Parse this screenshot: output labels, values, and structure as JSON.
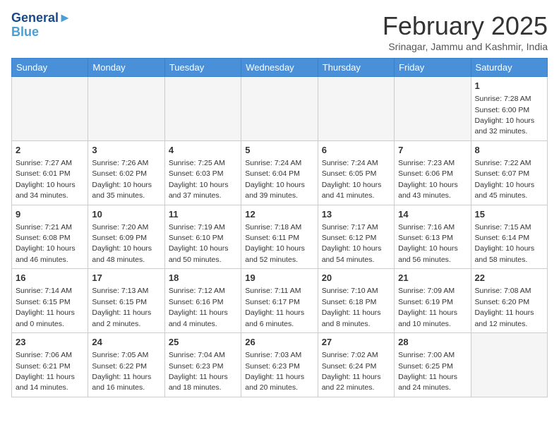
{
  "header": {
    "logo_line1": "General",
    "logo_line2": "Blue",
    "month_title": "February 2025",
    "location": "Srinagar, Jammu and Kashmir, India"
  },
  "days_of_week": [
    "Sunday",
    "Monday",
    "Tuesday",
    "Wednesday",
    "Thursday",
    "Friday",
    "Saturday"
  ],
  "weeks": [
    [
      {
        "num": "",
        "empty": true
      },
      {
        "num": "",
        "empty": true
      },
      {
        "num": "",
        "empty": true
      },
      {
        "num": "",
        "empty": true
      },
      {
        "num": "",
        "empty": true
      },
      {
        "num": "",
        "empty": true
      },
      {
        "num": "1",
        "rise": "7:28 AM",
        "set": "6:00 PM",
        "daylight": "10 hours and 32 minutes."
      }
    ],
    [
      {
        "num": "2",
        "rise": "7:27 AM",
        "set": "6:01 PM",
        "daylight": "10 hours and 34 minutes."
      },
      {
        "num": "3",
        "rise": "7:26 AM",
        "set": "6:02 PM",
        "daylight": "10 hours and 35 minutes."
      },
      {
        "num": "4",
        "rise": "7:25 AM",
        "set": "6:03 PM",
        "daylight": "10 hours and 37 minutes."
      },
      {
        "num": "5",
        "rise": "7:24 AM",
        "set": "6:04 PM",
        "daylight": "10 hours and 39 minutes."
      },
      {
        "num": "6",
        "rise": "7:24 AM",
        "set": "6:05 PM",
        "daylight": "10 hours and 41 minutes."
      },
      {
        "num": "7",
        "rise": "7:23 AM",
        "set": "6:06 PM",
        "daylight": "10 hours and 43 minutes."
      },
      {
        "num": "8",
        "rise": "7:22 AM",
        "set": "6:07 PM",
        "daylight": "10 hours and 45 minutes."
      }
    ],
    [
      {
        "num": "9",
        "rise": "7:21 AM",
        "set": "6:08 PM",
        "daylight": "10 hours and 46 minutes."
      },
      {
        "num": "10",
        "rise": "7:20 AM",
        "set": "6:09 PM",
        "daylight": "10 hours and 48 minutes."
      },
      {
        "num": "11",
        "rise": "7:19 AM",
        "set": "6:10 PM",
        "daylight": "10 hours and 50 minutes."
      },
      {
        "num": "12",
        "rise": "7:18 AM",
        "set": "6:11 PM",
        "daylight": "10 hours and 52 minutes."
      },
      {
        "num": "13",
        "rise": "7:17 AM",
        "set": "6:12 PM",
        "daylight": "10 hours and 54 minutes."
      },
      {
        "num": "14",
        "rise": "7:16 AM",
        "set": "6:13 PM",
        "daylight": "10 hours and 56 minutes."
      },
      {
        "num": "15",
        "rise": "7:15 AM",
        "set": "6:14 PM",
        "daylight": "10 hours and 58 minutes."
      }
    ],
    [
      {
        "num": "16",
        "rise": "7:14 AM",
        "set": "6:15 PM",
        "daylight": "11 hours and 0 minutes."
      },
      {
        "num": "17",
        "rise": "7:13 AM",
        "set": "6:15 PM",
        "daylight": "11 hours and 2 minutes."
      },
      {
        "num": "18",
        "rise": "7:12 AM",
        "set": "6:16 PM",
        "daylight": "11 hours and 4 minutes."
      },
      {
        "num": "19",
        "rise": "7:11 AM",
        "set": "6:17 PM",
        "daylight": "11 hours and 6 minutes."
      },
      {
        "num": "20",
        "rise": "7:10 AM",
        "set": "6:18 PM",
        "daylight": "11 hours and 8 minutes."
      },
      {
        "num": "21",
        "rise": "7:09 AM",
        "set": "6:19 PM",
        "daylight": "11 hours and 10 minutes."
      },
      {
        "num": "22",
        "rise": "7:08 AM",
        "set": "6:20 PM",
        "daylight": "11 hours and 12 minutes."
      }
    ],
    [
      {
        "num": "23",
        "rise": "7:06 AM",
        "set": "6:21 PM",
        "daylight": "11 hours and 14 minutes."
      },
      {
        "num": "24",
        "rise": "7:05 AM",
        "set": "6:22 PM",
        "daylight": "11 hours and 16 minutes."
      },
      {
        "num": "25",
        "rise": "7:04 AM",
        "set": "6:23 PM",
        "daylight": "11 hours and 18 minutes."
      },
      {
        "num": "26",
        "rise": "7:03 AM",
        "set": "6:23 PM",
        "daylight": "11 hours and 20 minutes."
      },
      {
        "num": "27",
        "rise": "7:02 AM",
        "set": "6:24 PM",
        "daylight": "11 hours and 22 minutes."
      },
      {
        "num": "28",
        "rise": "7:00 AM",
        "set": "6:25 PM",
        "daylight": "11 hours and 24 minutes."
      },
      {
        "num": "",
        "empty": true
      }
    ]
  ]
}
